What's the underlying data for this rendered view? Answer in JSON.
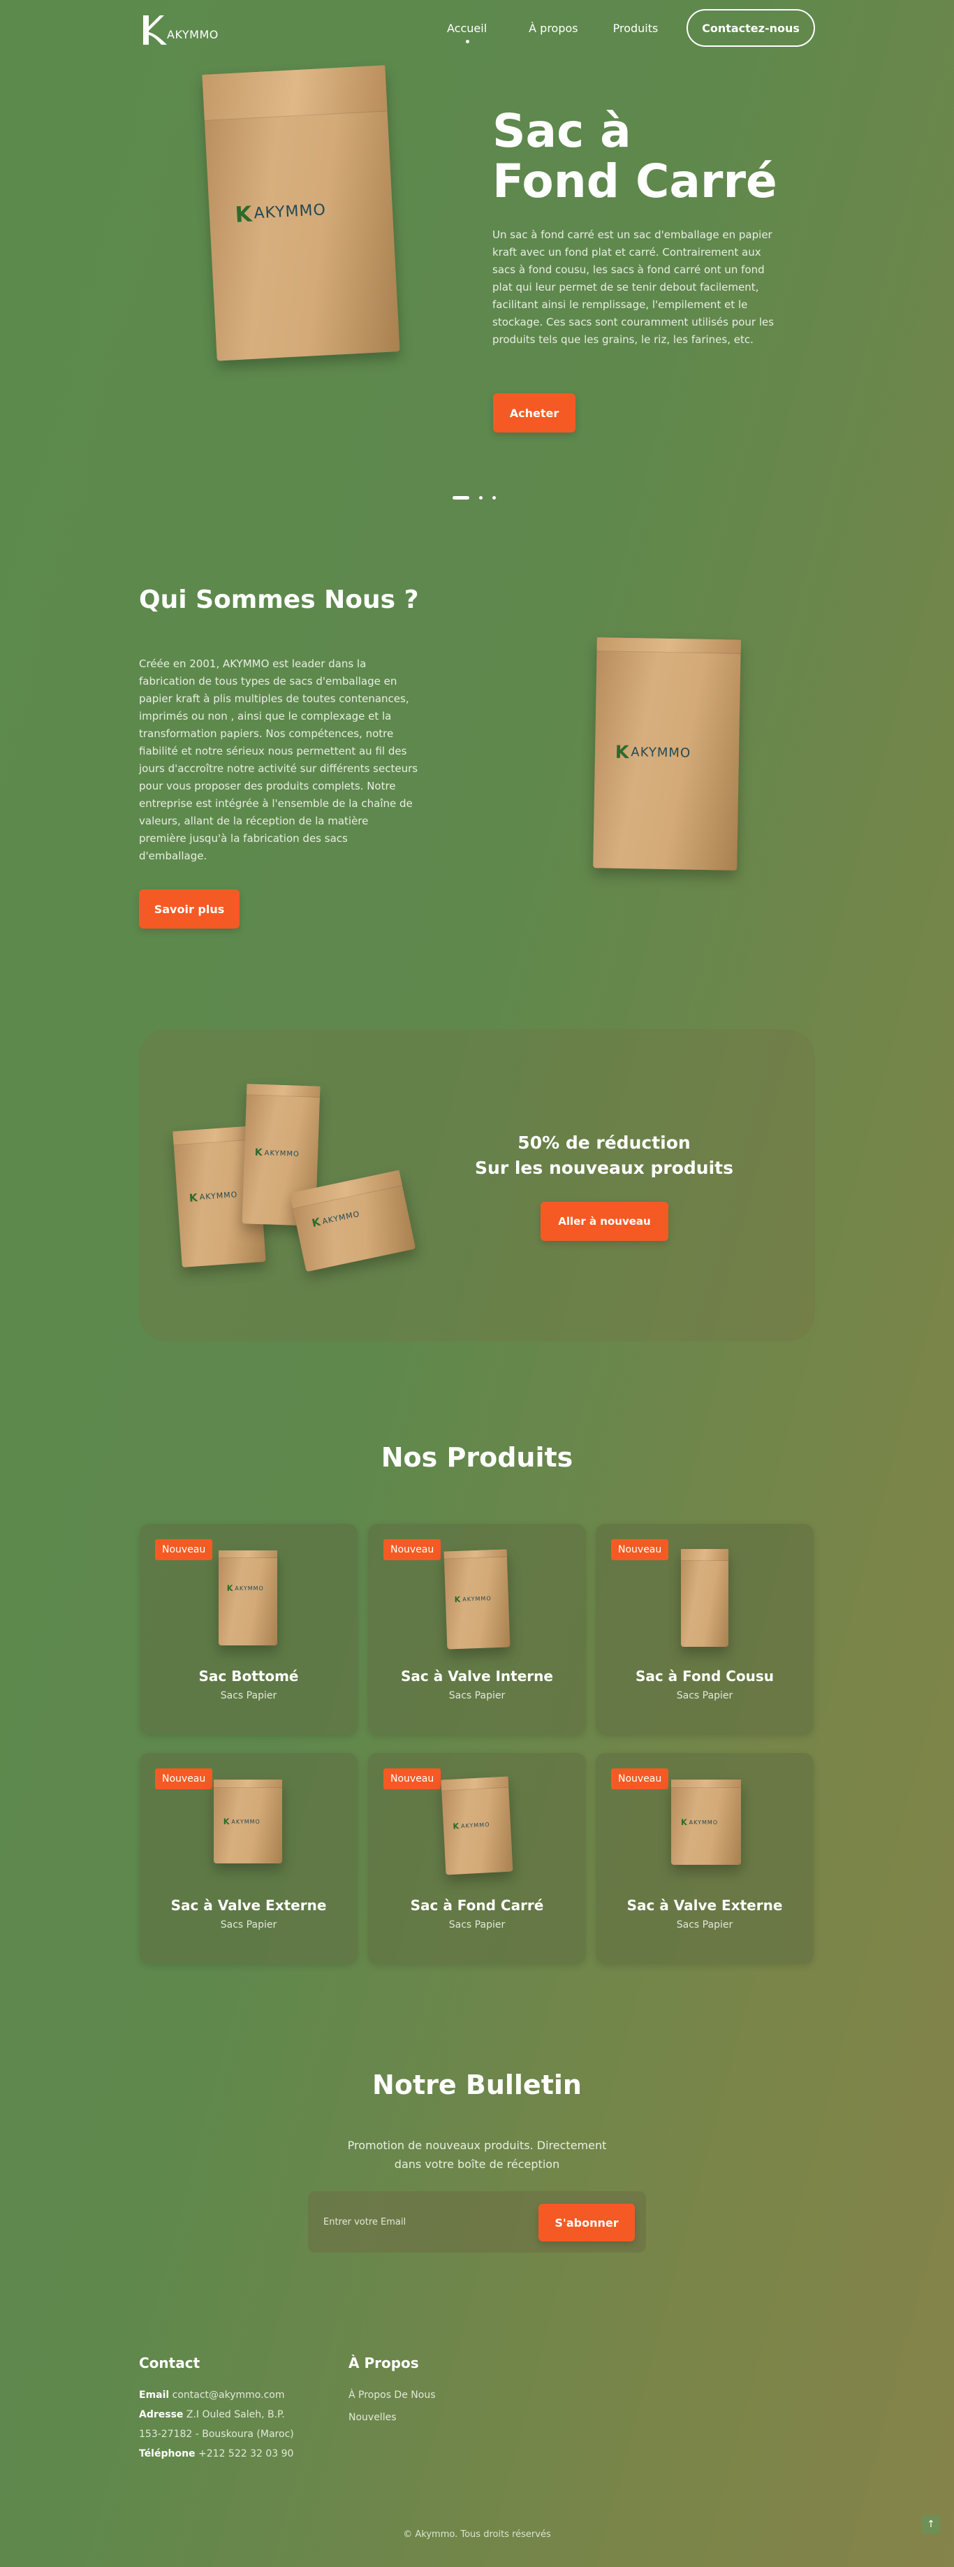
{
  "header": {
    "logo_text": "AKYMMO",
    "nav": [
      "Accueil",
      "À propos",
      "Produits"
    ],
    "contact_button": "Contactez-nous"
  },
  "hero": {
    "title_line1": "Sac à",
    "title_line2": "Fond Carré",
    "description": "Un sac à fond carré est un sac d'emballage en papier kraft avec un fond plat et carré. Contrairement aux sacs à fond cousu, les sacs à fond carré ont un fond plat qui leur permet de se tenir debout facilement, facilitant ainsi le remplissage, l'empilement et le stockage. Ces sacs sont couramment utilisés pour les produits tels que les grains, le riz, les farines, etc.",
    "button": "Acheter",
    "bag_logo": "AKYMMO"
  },
  "about": {
    "title": "Qui Sommes Nous ?",
    "text": "Créée en 2001, AKYMMO est leader dans la fabrication de tous types de sacs d'emballage en papier kraft à plis multiples de toutes contenances, imprimés ou non , ainsi que le complexage et la transformation papiers. Nos compétences, notre fiabilité et notre sérieux nous permettent au fil des jours d'accroître notre activité sur différents secteurs pour vous proposer des produits complets. Notre entreprise est intégrée à l'ensemble de la chaîne de valeurs, allant de la réception de la matière première jusqu'à la fabrication des sacs d'emballage.",
    "button": "Savoir plus",
    "bag_logo": "AKYMMO"
  },
  "promo": {
    "line1": "50% de réduction",
    "line2": "Sur les nouveaux produits",
    "button": "Aller à nouveau",
    "bag_logo": "AKYMMO"
  },
  "products": {
    "title": "Nos Produits",
    "badge": "Nouveau",
    "bag_logo": "AKYMMO",
    "items": [
      {
        "name": "Sac Bottomé",
        "category": "Sacs Papier"
      },
      {
        "name": "Sac à Valve Interne",
        "category": "Sacs Papier"
      },
      {
        "name": "Sac à Fond Cousu",
        "category": "Sacs Papier"
      },
      {
        "name": "Sac à Valve Externe",
        "category": "Sacs Papier"
      },
      {
        "name": "Sac à Fond Carré",
        "category": "Sacs Papier"
      },
      {
        "name": "Sac à Valve Externe",
        "category": "Sacs Papier"
      }
    ]
  },
  "newsletter": {
    "title": "Notre Bulletin",
    "text": "Promotion de nouveaux produits. Directement dans votre boîte de réception",
    "placeholder": "Entrer votre Email",
    "button": "S'abonner"
  },
  "footer": {
    "contact_title": "Contact",
    "email_label": "Email",
    "email_value": "contact@akymmo.com",
    "address_label": "Adresse",
    "address_value": "Z.I Ouled Saleh, B.P. 153-27182 - Bouskoura (Maroc)",
    "phone_label": "Téléphone",
    "phone_value": "+212 522 32 03 90",
    "about_title": "À Propos",
    "about_links": [
      "À Propos De Nous",
      "Nouvelles"
    ],
    "copyright": "© Akymmo. Tous droits réservés"
  },
  "colors": {
    "accent": "#f55a24",
    "background_start": "#5c8a4d",
    "background_end": "#85844a"
  }
}
